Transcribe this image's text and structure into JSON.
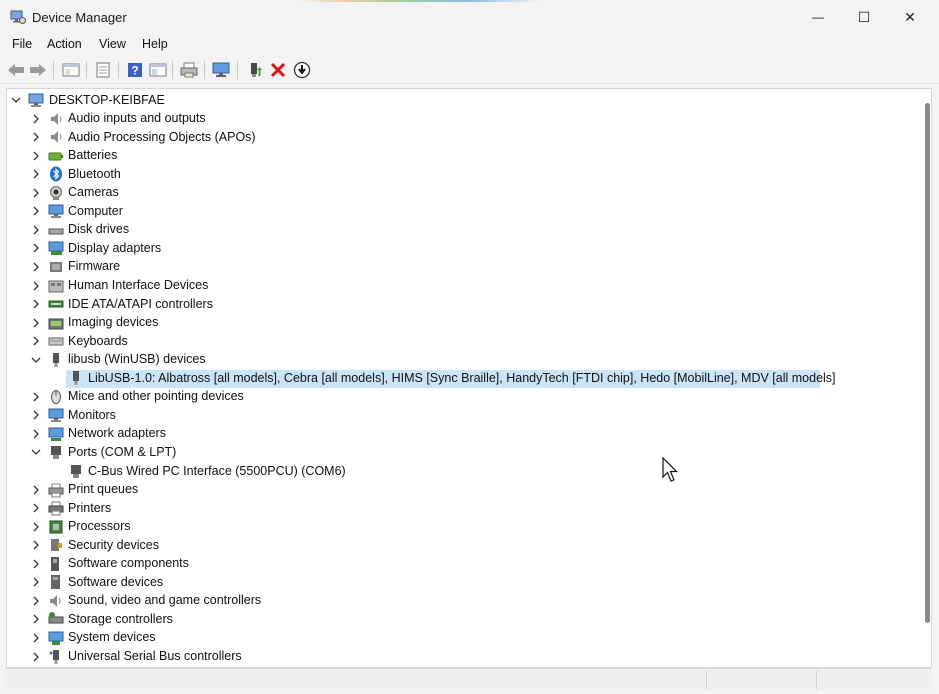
{
  "window": {
    "title": "Device Manager",
    "controls": {
      "minimize": "—",
      "maximize": "☐",
      "close": "✕"
    }
  },
  "menu": [
    "File",
    "Action",
    "View",
    "Help"
  ],
  "toolbar": {
    "buttons": [
      "back-icon",
      "forward-icon",
      "properties-icon",
      "scan-icon",
      "help-icon",
      "view-icon",
      "print-icon",
      "monitor-icon",
      "update-driver-icon",
      "uninstall-icon",
      "disable-icon"
    ]
  },
  "tree": {
    "root": "DESKTOP-KEIBFAE",
    "categories": [
      {
        "label": "Audio inputs and outputs",
        "expanded": false
      },
      {
        "label": "Audio Processing Objects (APOs)",
        "expanded": false
      },
      {
        "label": "Batteries",
        "expanded": false
      },
      {
        "label": "Bluetooth",
        "expanded": false
      },
      {
        "label": "Cameras",
        "expanded": false
      },
      {
        "label": "Computer",
        "expanded": false
      },
      {
        "label": "Disk drives",
        "expanded": false
      },
      {
        "label": "Display adapters",
        "expanded": false
      },
      {
        "label": "Firmware",
        "expanded": false
      },
      {
        "label": "Human Interface Devices",
        "expanded": false
      },
      {
        "label": "IDE ATA/ATAPI controllers",
        "expanded": false
      },
      {
        "label": "Imaging devices",
        "expanded": false
      },
      {
        "label": "Keyboards",
        "expanded": false
      },
      {
        "label": "libusb (WinUSB) devices",
        "expanded": true
      },
      {
        "label": "Mice and other pointing devices",
        "expanded": false
      },
      {
        "label": "Monitors",
        "expanded": false
      },
      {
        "label": "Network adapters",
        "expanded": false
      },
      {
        "label": "Ports (COM & LPT)",
        "expanded": true
      },
      {
        "label": "Print queues",
        "expanded": false
      },
      {
        "label": "Printers",
        "expanded": false
      },
      {
        "label": "Processors",
        "expanded": false
      },
      {
        "label": "Security devices",
        "expanded": false
      },
      {
        "label": "Software components",
        "expanded": false
      },
      {
        "label": "Software devices",
        "expanded": false
      },
      {
        "label": "Sound, video and game controllers",
        "expanded": false
      },
      {
        "label": "Storage controllers",
        "expanded": false
      },
      {
        "label": "System devices",
        "expanded": false
      },
      {
        "label": "Universal Serial Bus controllers",
        "expanded": false
      }
    ],
    "libusb_child": "LibUSB-1.0: Albatross [all models], Cebra [all models], HIMS [Sync Braille], HandyTech [FTDI chip], Hedo [MobilLine], MDV [all models]",
    "ports_child": "C-Bus Wired PC Interface (5500PCU) (COM6)"
  },
  "colors": {
    "selection": "#cce4f7",
    "background": "#f3f3f3"
  }
}
